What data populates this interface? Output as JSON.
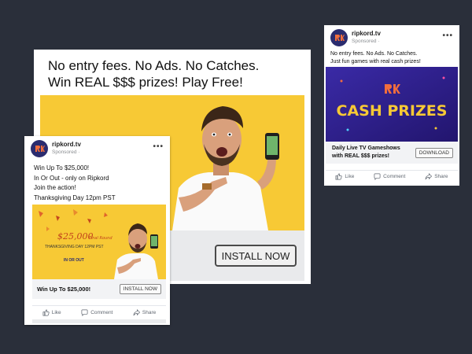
{
  "big_ad": {
    "headline_line1": "No entry fees. No Ads. No Catches.",
    "headline_line2": "Win REAL $$$ prizes! Play Free!",
    "install_label": "INSTALL NOW"
  },
  "left_post": {
    "page_name": "ripkord.tv",
    "sponsored": "Sponsored · ",
    "lines": [
      "Win Up To $25,000!",
      "In Or Out - only on Ripkord",
      "Join the action!",
      "Thanksgiving Day 12pm PST"
    ],
    "creative": {
      "prize": "$25,000",
      "prize_tag": "Final Round",
      "date_line": "THANKSGIVING DAY 12PM PST",
      "brand": "IN OR OUT"
    },
    "footer_headline": "Win Up To $25,000!",
    "cta": "INSTALL NOW",
    "actions": [
      "Like",
      "Comment",
      "Share"
    ]
  },
  "right_post": {
    "page_name": "ripkord.tv",
    "sponsored": "Sponsored · ",
    "lines": [
      "No entry fees. No Ads. No Catches.",
      "Just fun games with real cash prizes!"
    ],
    "creative_text": "CASH PRIZES",
    "footer_headline": "Daily Live TV Gameshows with REAL $$$ prizes!",
    "cta": "DOWNLOAD",
    "actions": [
      "Like",
      "Comment",
      "Share"
    ]
  },
  "colors": {
    "background": "#2a2f3a",
    "yellow": "#f7c935",
    "brand_orange": "#f26d3d",
    "logo_navy": "#2b2c6f",
    "cash_purple": "#2e1f8f"
  }
}
